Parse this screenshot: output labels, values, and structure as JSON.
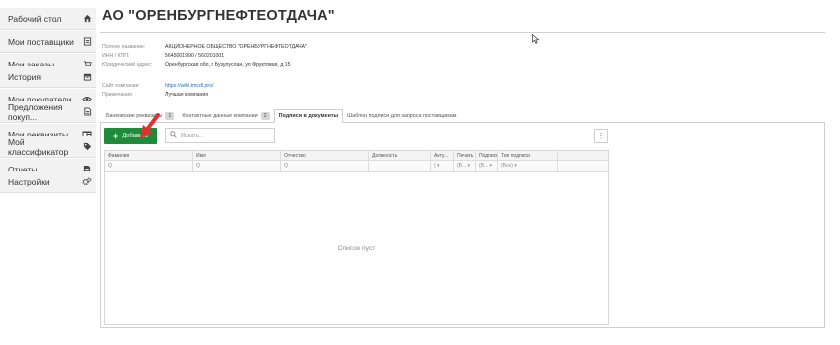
{
  "sidebar": {
    "items": [
      {
        "label": "Рабочий стол",
        "icon": "home-icon"
      },
      {
        "label": "Мои поставщики",
        "icon": "document-icon"
      },
      {
        "label": "Мои заказы",
        "icon": "cart-icon"
      },
      {
        "label": "История",
        "icon": "archive-icon"
      },
      {
        "label": "Мои покупатели",
        "icon": "eye-icon"
      },
      {
        "label": "Предложения покуп...",
        "icon": "file-icon"
      },
      {
        "label": "Мои реквизиты",
        "icon": "card-icon"
      },
      {
        "label": "Мой классификатор",
        "icon": "tag-icon"
      },
      {
        "label": "Отчеты",
        "icon": "report-icon"
      },
      {
        "label": "Настройки",
        "icon": "gears-icon"
      }
    ]
  },
  "company": {
    "title": "АО \"ОРЕНБУРГНЕФТЕОТДАЧА\"",
    "full_name_label": "Полное название:",
    "full_name": "АКЦИОНЕРНОЕ ОБЩЕСТВО \"ОРЕНБУРГНЕФТЕОТДАЧА\"",
    "inn_label": "ИНН / КПП:",
    "inn": "5645001990 / 560201001",
    "address_label": "Юридический адрес:",
    "address": "Оренбургская обл, г Бузулуслан, ул Фруктовая, д 15",
    "site_label": "Сайт компании:",
    "site": "https://wiki.tmcdl.pro/",
    "note_label": "Примечание:",
    "note": "Лучшая компания"
  },
  "tabs": [
    {
      "label": "Банковские реквизиты",
      "badge": "1",
      "active": false
    },
    {
      "label": "Контактные данные компании",
      "badge": "2",
      "active": false
    },
    {
      "label": "Подписи в документы",
      "badge": "",
      "active": true
    },
    {
      "label": "Шаблон подписи для запроса поставщикам",
      "badge": "",
      "active": false
    }
  ],
  "toolbar": {
    "add_label": "Добавить",
    "search_placeholder": "Искать...",
    "menu_glyph": "⋮"
  },
  "table": {
    "columns": [
      "Фамилия",
      "Имя",
      "Отчество",
      "Должность",
      "Акту...",
      "Печать",
      "Подпись",
      "Тип подписи",
      ""
    ],
    "filters": [
      "Q",
      "Q",
      "Q",
      "",
      "( ▾",
      "(В... ▾",
      "(В... ▾",
      "(Все) ▾",
      ""
    ],
    "empty_text": "Список пуст"
  },
  "colors": {
    "accent_green": "#1e8b3a",
    "arrow_red": "#e03131",
    "link_blue": "#2a6ebb"
  }
}
